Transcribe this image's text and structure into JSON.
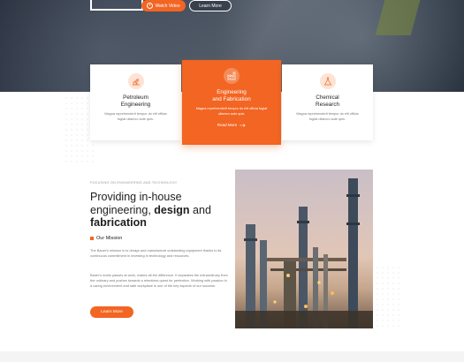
{
  "hero": {
    "watch_label": "Watch Video",
    "learn_label": "Learn More"
  },
  "services": [
    {
      "title_line1": "Petroleum",
      "title_line2": "Engineering",
      "desc": "Magna reprehenderit tempor do elit officia fugiat ullamco aute quis.",
      "icon": "oil-pump-icon"
    },
    {
      "title_line1": "Engineering",
      "title_line2": "and Fabrication",
      "desc": "Magna reprehenderit tempor do elit officia fugiat ullamco aute quis.",
      "read_more": "Read More",
      "icon": "factory-icon"
    },
    {
      "title_line1": "Chemical",
      "title_line2": "Research",
      "desc": "Magna reprehenderit tempor do elit officia fugiat ullamco aute quis.",
      "icon": "flask-icon"
    }
  ],
  "about": {
    "eyebrow": "FOCUSING ON ENGINEERING AND TECHNOLOGY",
    "headline_a": "Providing in-house",
    "headline_b": "engineering, ",
    "headline_bold1": "design",
    "headline_c": " and",
    "headline_bold2": "fabrication",
    "mission_label": "Our Mission",
    "para1": "The Bauer's mission is to design and manufacture outstanding equipment thanks to its continuous commitment in investing in technology and resources.",
    "para2": "Bauer's motto passes at work, makes all the difference. It separates the extraordinary from the ordinary and pushes towards a relentless quest for perfection. Working with passion in a caring environment and safe workplace is one of the key aspects of our success.",
    "button_label": "Learn More"
  },
  "colors": {
    "accent": "#f26522",
    "dark_text": "#1e1e1e",
    "muted_text": "#777777"
  }
}
